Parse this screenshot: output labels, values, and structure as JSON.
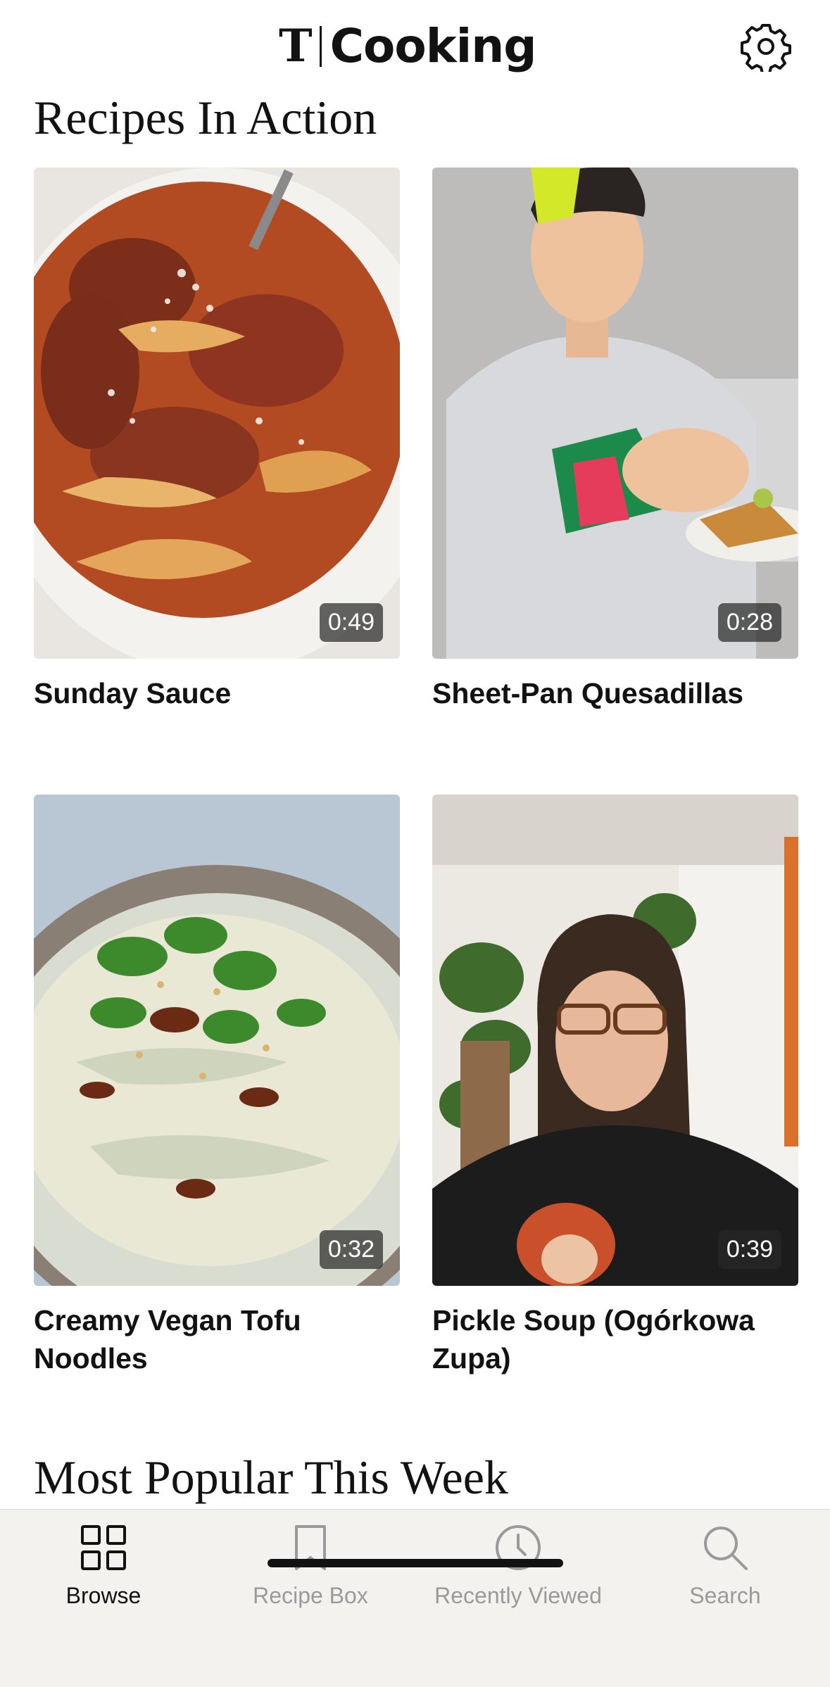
{
  "header": {
    "logo_mark": "T",
    "logo_word": "Cooking"
  },
  "section_recipes_in_action": {
    "title": "Recipes In Action",
    "cards": [
      {
        "title": "Sunday Sauce",
        "duration": "0:49"
      },
      {
        "title": "Sheet-Pan Quesadillas",
        "duration": "0:28"
      },
      {
        "title": "Creamy Vegan Tofu Noodles",
        "duration": "0:32"
      },
      {
        "title": "Pickle Soup (Ogórkowa Zupa)",
        "duration": "0:39"
      }
    ]
  },
  "section_most_popular": {
    "title": "Most Popular This Week"
  },
  "tabbar": {
    "tabs": [
      {
        "label": "Browse",
        "icon": "grid-icon",
        "active": true
      },
      {
        "label": "Recipe Box",
        "icon": "bookmark-icon",
        "active": false
      },
      {
        "label": "Recently Viewed",
        "icon": "clock-icon",
        "active": false
      },
      {
        "label": "Search",
        "icon": "search-icon",
        "active": false
      }
    ]
  },
  "colors": {
    "text": "#121212",
    "inactive": "#9a9a9a",
    "tabbar_bg": "#f3f2ef"
  }
}
